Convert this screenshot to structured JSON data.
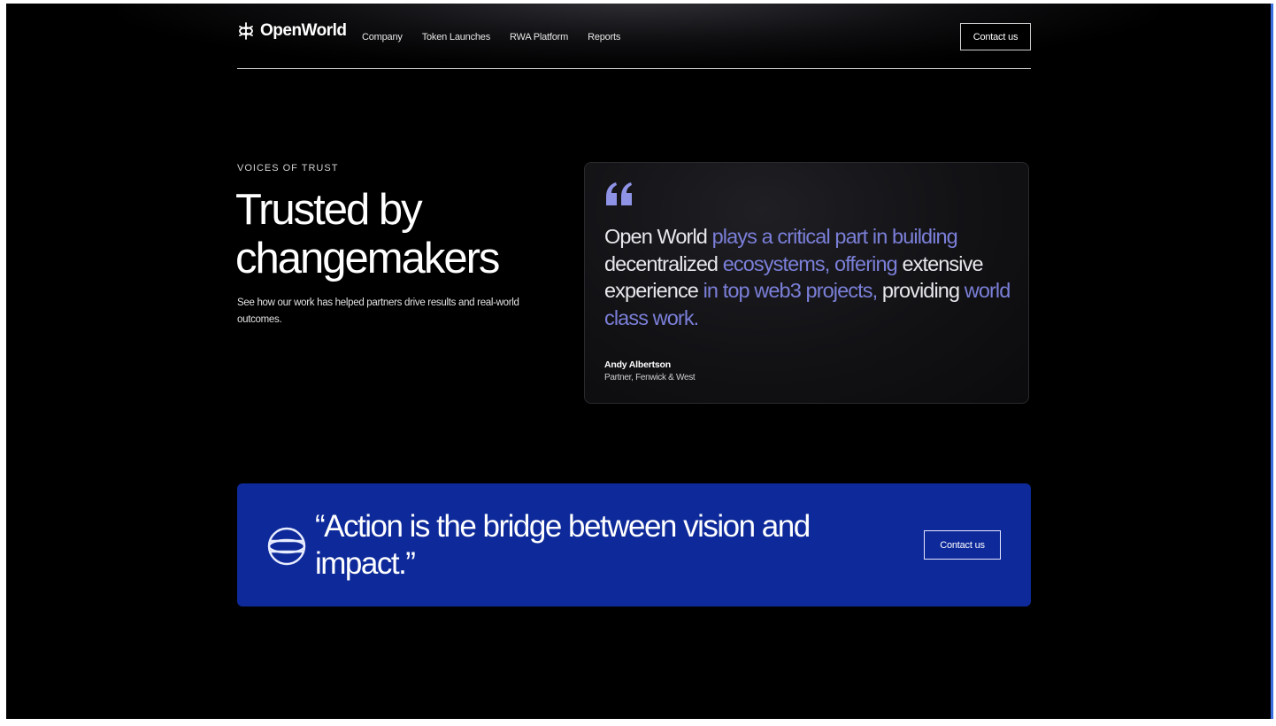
{
  "brand": {
    "name": "OpenWorld",
    "accent_blue": "#0e2a9a",
    "quote_blue": "#7b7fd8",
    "background": "#000000"
  },
  "nav": {
    "links": [
      "Company",
      "Token Launches",
      "RWA Platform",
      "Reports"
    ],
    "contact_label": "Contact us"
  },
  "testimonials": {
    "eyebrow": "VOICES OF TRUST",
    "headline_line1": "Trusted by",
    "headline_line2": "changemakers",
    "subtext": "See how our work has helped partners drive results and real-world outcomes."
  },
  "quote_card": {
    "icon": "quote-icon",
    "segments": [
      {
        "text": "Open World ",
        "tone": "white"
      },
      {
        "text": "plays a critical part in building",
        "tone": "blue"
      },
      {
        "text": " decentralized ",
        "tone": "white"
      },
      {
        "text": "ecosystems, offering",
        "tone": "blue"
      },
      {
        "text": " extensive experience ",
        "tone": "white"
      },
      {
        "text": "in top web3 projects,",
        "tone": "blue"
      },
      {
        "text": " providing ",
        "tone": "white"
      },
      {
        "text": "world class work.",
        "tone": "blue"
      }
    ],
    "author_name": "Andy Albertson",
    "author_role": "Partner, Fenwick & West"
  },
  "cta": {
    "icon": "globe-icon",
    "quote_line1": "“Action is the bridge between vision and",
    "quote_line2": "impact.”",
    "contact_label": "Contact us"
  }
}
